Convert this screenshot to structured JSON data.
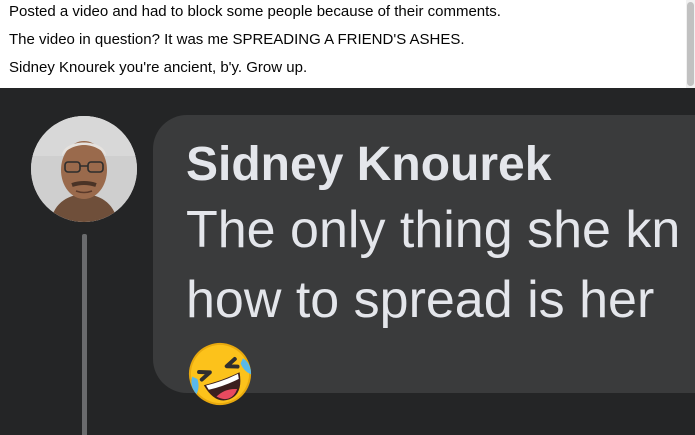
{
  "post": {
    "lines": [
      "Posted a video and had to block some people because of their comments.",
      "The video in question? It was me SPREADING A FRIEND'S ASHES.",
      "Sidney Knourek you're ancient, b'y. Grow up."
    ]
  },
  "comment": {
    "author": "Sidney Knourek",
    "lines": [
      "The only thing she kn",
      "how to spread is her"
    ],
    "emoji": "rolling-on-the-floor-laughing-icon"
  },
  "colors": {
    "dark_background": "#242526",
    "bubble": "#3a3b3c",
    "comment_text": "#e4e6eb",
    "post_text": "#050505"
  }
}
